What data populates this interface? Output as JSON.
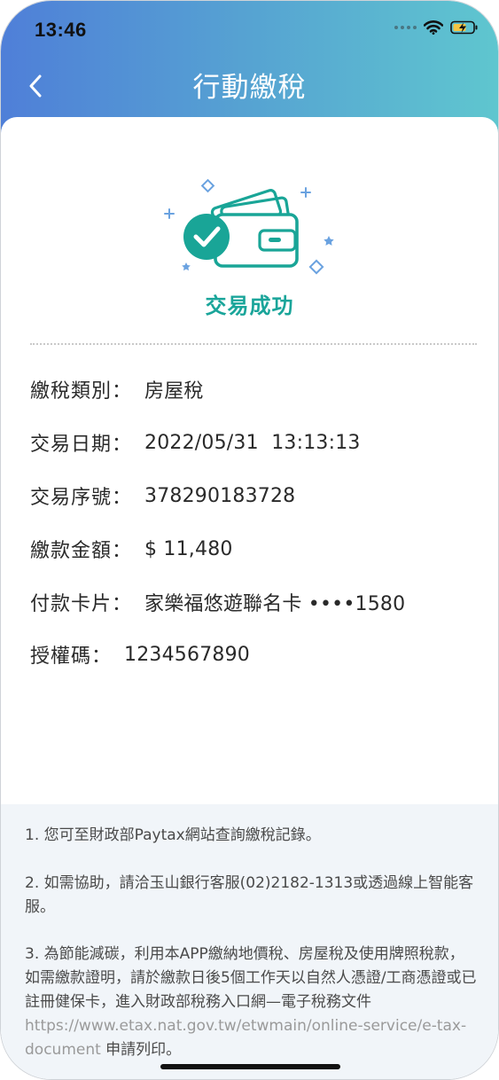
{
  "status_bar": {
    "time": "13:46"
  },
  "header": {
    "title": "行動繳稅",
    "back_icon": "chevron-left-icon"
  },
  "result": {
    "icon": "wallet-check-icon",
    "title": "交易成功",
    "accent_color": "#1aa59a"
  },
  "details": [
    {
      "label": "繳稅類別：",
      "value": "房屋稅"
    },
    {
      "label": "交易日期：",
      "value": "2022/05/31  13:13:13"
    },
    {
      "label": "交易序號：",
      "value": "378290183728"
    },
    {
      "label": "繳款金額：",
      "value": "$ 11,480"
    },
    {
      "label": "付款卡片：",
      "value": "家樂福悠遊聯名卡 ••••1580"
    },
    {
      "label": "授權碼：",
      "value": "1234567890"
    }
  ],
  "notes": {
    "note1": "1. 您可至財政部Paytax網站查詢繳稅記錄。",
    "note2": "2. 如需協助，請洽玉山銀行客服(02)2182-1313或透過線上智能客服。",
    "note3_prefix": "3. 為節能減碳，利用本APP繳納地價稅、房屋稅及使用牌照稅款，如需繳款證明，請於繳款日後5個工作天以自然人憑證/工商憑證或已註冊健保卡，進入財政部稅務入口網—電子稅務文件 ",
    "note3_url": "https://www.etax.nat.gov.tw/etwmain/online-service/e-tax-document",
    "note3_suffix": " 申請列印。"
  }
}
